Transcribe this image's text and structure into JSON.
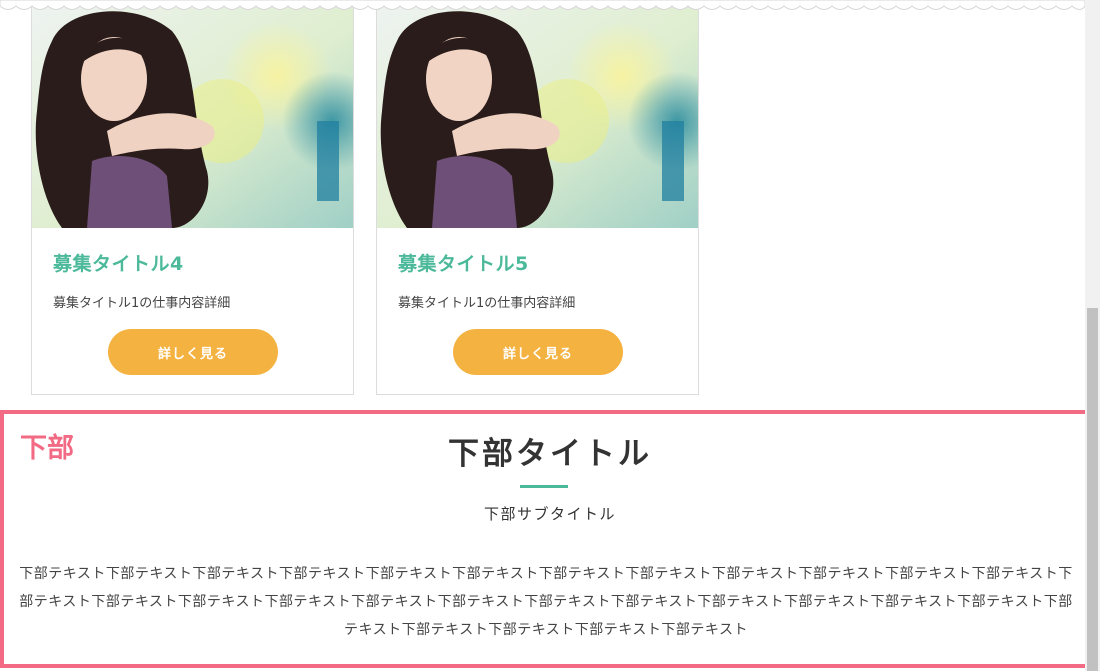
{
  "cards": [
    {
      "title": "募集タイトル4",
      "description": "募集タイトル1の仕事内容詳細",
      "button_label": "詳しく見る"
    },
    {
      "title": "募集タイトル5",
      "description": "募集タイトル1の仕事内容詳細",
      "button_label": "詳しく見る"
    }
  ],
  "bottom_section": {
    "tag": "下部",
    "title": "下部タイトル",
    "subtitle": "下部サブタイトル",
    "text": "下部テキスト下部テキスト下部テキスト下部テキスト下部テキスト下部テキスト下部テキスト下部テキスト下部テキスト下部テキスト下部テキスト下部テキスト下部テキスト下部テキスト下部テキスト下部テキスト下部テキスト下部テキスト下部テキスト下部テキスト下部テキスト下部テキスト下部テキスト下部テキスト下部テキスト下部テキスト下部テキスト下部テキスト下部テキスト"
  },
  "colors": {
    "accent_green": "#4bb99a",
    "button_orange": "#f4b240",
    "highlight_pink": "#f26a83"
  }
}
